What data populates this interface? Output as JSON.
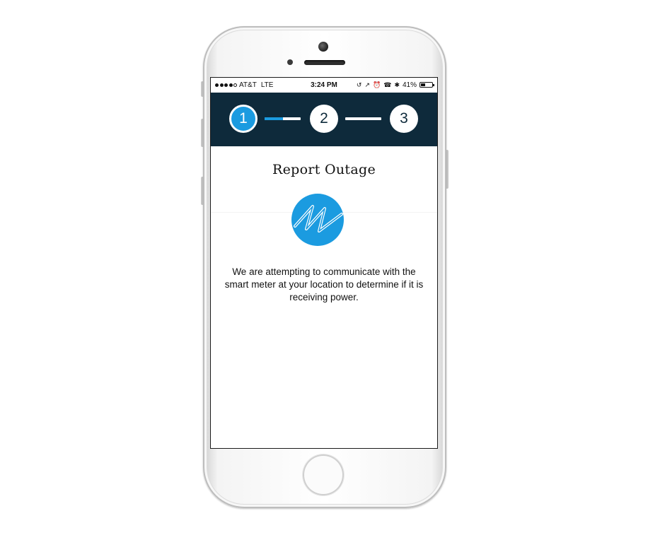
{
  "status_bar": {
    "carrier": "AT&T",
    "network": "LTE",
    "time": "3:24 PM",
    "battery": "41%",
    "battery_level": 0.41,
    "signal_bars_filled": 4,
    "icons": [
      "screen-lock-icon",
      "location-arrow-icon",
      "alarm-icon",
      "tty-icon",
      "bluetooth-icon"
    ]
  },
  "stepper": {
    "steps": [
      {
        "label": "1",
        "state": "active"
      },
      {
        "label": "2",
        "state": "pending"
      },
      {
        "label": "3",
        "state": "pending"
      }
    ],
    "progress_1_to_2": 0.5,
    "colors": {
      "bar_background": "#0e2a3b",
      "accent": "#1b9be0"
    }
  },
  "content": {
    "title": "Report Outage",
    "logo": "utility-brand-logo",
    "message": "We are attempting to communicate with the smart meter at your location to determine if it is receiving power."
  }
}
